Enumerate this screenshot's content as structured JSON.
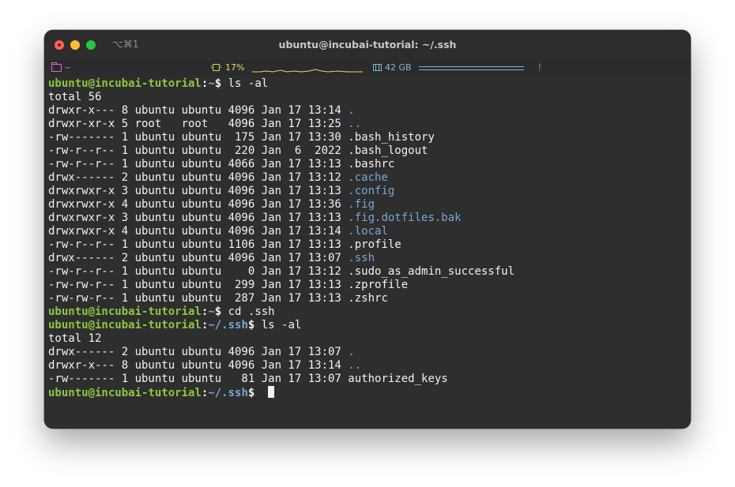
{
  "window": {
    "title": "ubuntu@incubai-tutorial: ~/.ssh",
    "shortcut": "⌥⌘1",
    "colors": {
      "close": "#fe5f57",
      "minimize": "#febc2e",
      "zoom": "#28c840"
    }
  },
  "statusbar": {
    "cwd": "~",
    "cpu": "17%",
    "memory": "42 GB",
    "icons": [
      "folder-icon",
      "cpu-icon",
      "memory-icon",
      "branch-icon"
    ]
  },
  "terminal": {
    "prompt_user": "ubuntu@incubai-tutorial",
    "lines": [
      {
        "type": "prompt",
        "path": "~",
        "command": "ls -al"
      },
      {
        "type": "text",
        "text": "total 56"
      },
      {
        "type": "entry",
        "meta": "drwxr-x--- 8 ubuntu ubuntu 4096 Jan 17 13:14 ",
        "name": ".",
        "dir": true
      },
      {
        "type": "entry",
        "meta": "drwxr-xr-x 5 root   root   4096 Jan 17 13:25 ",
        "name": "..",
        "dir": true
      },
      {
        "type": "entry",
        "meta": "-rw------- 1 ubuntu ubuntu  175 Jan 17 13:30 ",
        "name": ".bash_history",
        "dir": false
      },
      {
        "type": "entry",
        "meta": "-rw-r--r-- 1 ubuntu ubuntu  220 Jan  6  2022 ",
        "name": ".bash_logout",
        "dir": false
      },
      {
        "type": "entry",
        "meta": "-rw-r--r-- 1 ubuntu ubuntu 4066 Jan 17 13:13 ",
        "name": ".bashrc",
        "dir": false
      },
      {
        "type": "entry",
        "meta": "drwx------ 2 ubuntu ubuntu 4096 Jan 17 13:12 ",
        "name": ".cache",
        "dir": true
      },
      {
        "type": "entry",
        "meta": "drwxrwxr-x 3 ubuntu ubuntu 4096 Jan 17 13:13 ",
        "name": ".config",
        "dir": true
      },
      {
        "type": "entry",
        "meta": "drwxrwxr-x 4 ubuntu ubuntu 4096 Jan 17 13:36 ",
        "name": ".fig",
        "dir": true
      },
      {
        "type": "entry",
        "meta": "drwxrwxr-x 3 ubuntu ubuntu 4096 Jan 17 13:13 ",
        "name": ".fig.dotfiles.bak",
        "dir": true
      },
      {
        "type": "entry",
        "meta": "drwxrwxr-x 4 ubuntu ubuntu 4096 Jan 17 13:14 ",
        "name": ".local",
        "dir": true
      },
      {
        "type": "entry",
        "meta": "-rw-r--r-- 1 ubuntu ubuntu 1106 Jan 17 13:13 ",
        "name": ".profile",
        "dir": false
      },
      {
        "type": "entry",
        "meta": "drwx------ 2 ubuntu ubuntu 4096 Jan 17 13:07 ",
        "name": ".ssh",
        "dir": true
      },
      {
        "type": "entry",
        "meta": "-rw-r--r-- 1 ubuntu ubuntu    0 Jan 17 13:12 ",
        "name": ".sudo_as_admin_successful",
        "dir": false
      },
      {
        "type": "entry",
        "meta": "-rw-rw-r-- 1 ubuntu ubuntu  299 Jan 17 13:13 ",
        "name": ".zprofile",
        "dir": false
      },
      {
        "type": "entry",
        "meta": "-rw-rw-r-- 1 ubuntu ubuntu  287 Jan 17 13:13 ",
        "name": ".zshrc",
        "dir": false
      },
      {
        "type": "prompt",
        "path": "~",
        "command": "cd .ssh"
      },
      {
        "type": "prompt",
        "path": "~/.ssh",
        "command": "ls -al"
      },
      {
        "type": "text",
        "text": "total 12"
      },
      {
        "type": "entry",
        "meta": "drwx------ 2 ubuntu ubuntu 4096 Jan 17 13:07 ",
        "name": ".",
        "dir": true
      },
      {
        "type": "entry",
        "meta": "drwxr-x--- 8 ubuntu ubuntu 4096 Jan 17 13:14 ",
        "name": "..",
        "dir": true
      },
      {
        "type": "entry",
        "meta": "-rw------- 1 ubuntu ubuntu   81 Jan 17 13:07 ",
        "name": "authorized_keys",
        "dir": false
      },
      {
        "type": "prompt",
        "path": "~/.ssh",
        "command": "",
        "cursor": true
      }
    ]
  },
  "colors": {
    "background": "#2e2e2e",
    "prompt_user": "#8ec63f",
    "directory": "#7aa6d8",
    "text": "#f2f2f2",
    "cwd_accent": "#d56bd2",
    "cpu_accent": "#e6d96a",
    "memory_accent": "#7fb7d9"
  }
}
